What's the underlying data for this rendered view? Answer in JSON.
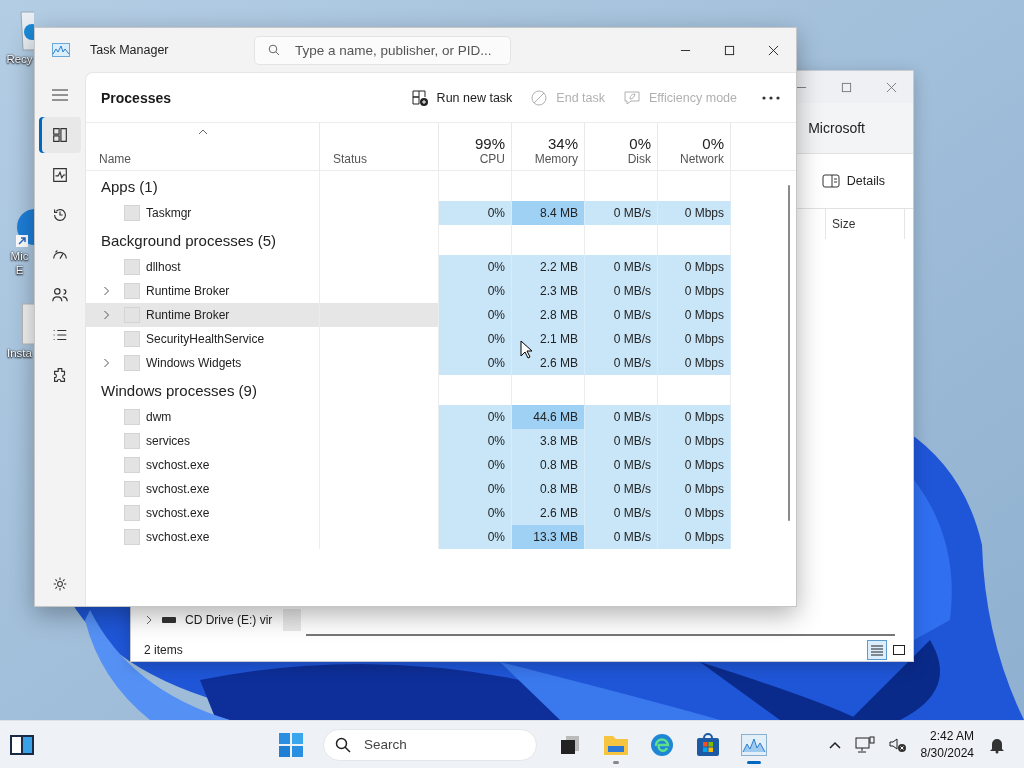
{
  "desktop": {
    "icons": [
      {
        "kind": "recycle",
        "lines": [
          "Recy"
        ]
      },
      {
        "kind": "edge",
        "lines": [
          "Mic",
          "E"
        ]
      },
      {
        "kind": "installer",
        "lines": [
          "Insta"
        ]
      }
    ]
  },
  "explorer": {
    "address": "Microsoft",
    "toolbar_button": "Details",
    "columns": [
      "Size"
    ],
    "nav_row": {
      "label": "CD Drive (E:) vir",
      "expandable": true
    },
    "status": "2 items",
    "views": [
      {
        "kind": "details",
        "selected": true
      },
      {
        "kind": "tiles",
        "selected": false
      }
    ]
  },
  "task_manager": {
    "title": "Task Manager",
    "search": {
      "placeholder": "Type a name, publisher, or PID..."
    },
    "nav": [
      {
        "kind": "processes",
        "selected": true
      },
      {
        "kind": "performance",
        "selected": false
      },
      {
        "kind": "history",
        "selected": false
      },
      {
        "kind": "startup",
        "selected": false
      },
      {
        "kind": "users",
        "selected": false
      },
      {
        "kind": "details",
        "selected": false
      },
      {
        "kind": "services",
        "selected": false
      }
    ],
    "page_title": "Processes",
    "toolbar": [
      {
        "kind": "run",
        "label": "Run new task",
        "disabled": false
      },
      {
        "kind": "end",
        "label": "End task",
        "disabled": true
      },
      {
        "kind": "efficiency",
        "label": "Efficiency mode",
        "disabled": true
      }
    ],
    "columns": [
      {
        "label": "Name",
        "sorted": true
      },
      {
        "label": "Status",
        "sorted": false
      },
      {
        "label": "CPU",
        "percent": "99%",
        "sorted": false
      },
      {
        "label": "Memory",
        "percent": "34%",
        "sorted": false
      },
      {
        "label": "Disk",
        "percent": "0%",
        "sorted": false
      },
      {
        "label": "Network",
        "percent": "0%",
        "sorted": false
      }
    ],
    "groups": [
      {
        "title": "Apps (1)",
        "rows": [
          {
            "name": "Taskmgr",
            "expandable": false,
            "hovered": false,
            "cpu": "0%",
            "memory": "8.4 MB",
            "memory_high": true,
            "disk": "0 MB/s",
            "network": "0 Mbps"
          }
        ]
      },
      {
        "title": "Background processes (5)",
        "rows": [
          {
            "name": "dllhost",
            "expandable": false,
            "hovered": false,
            "cpu": "0%",
            "memory": "2.2 MB",
            "memory_high": false,
            "disk": "0 MB/s",
            "network": "0 Mbps"
          },
          {
            "name": "Runtime Broker",
            "expandable": true,
            "hovered": false,
            "cpu": "0%",
            "memory": "2.3 MB",
            "memory_high": false,
            "disk": "0 MB/s",
            "network": "0 Mbps"
          },
          {
            "name": "Runtime Broker",
            "expandable": true,
            "hovered": true,
            "cpu": "0%",
            "memory": "2.8 MB",
            "memory_high": false,
            "disk": "0 MB/s",
            "network": "0 Mbps"
          },
          {
            "name": "SecurityHealthService",
            "expandable": false,
            "hovered": false,
            "cpu": "0%",
            "memory": "2.1 MB",
            "memory_high": false,
            "disk": "0 MB/s",
            "network": "0 Mbps"
          },
          {
            "name": "Windows Widgets",
            "expandable": true,
            "hovered": false,
            "cpu": "0%",
            "memory": "2.6 MB",
            "memory_high": false,
            "disk": "0 MB/s",
            "network": "0 Mbps"
          }
        ]
      },
      {
        "title": "Windows processes (9)",
        "rows": [
          {
            "name": "dwm",
            "expandable": false,
            "hovered": false,
            "cpu": "0%",
            "memory": "44.6 MB",
            "memory_high": true,
            "disk": "0 MB/s",
            "network": "0 Mbps"
          },
          {
            "name": "services",
            "expandable": false,
            "hovered": false,
            "cpu": "0%",
            "memory": "3.8 MB",
            "memory_high": false,
            "disk": "0 MB/s",
            "network": "0 Mbps"
          },
          {
            "name": "svchost.exe",
            "expandable": false,
            "hovered": false,
            "cpu": "0%",
            "memory": "0.8 MB",
            "memory_high": false,
            "disk": "0 MB/s",
            "network": "0 Mbps"
          },
          {
            "name": "svchost.exe",
            "expandable": false,
            "hovered": false,
            "cpu": "0%",
            "memory": "0.8 MB",
            "memory_high": false,
            "disk": "0 MB/s",
            "network": "0 Mbps"
          },
          {
            "name": "svchost.exe",
            "expandable": false,
            "hovered": false,
            "cpu": "0%",
            "memory": "2.6 MB",
            "memory_high": false,
            "disk": "0 MB/s",
            "network": "0 Mbps"
          },
          {
            "name": "svchost.exe",
            "expandable": false,
            "hovered": false,
            "cpu": "0%",
            "memory": "13.3 MB",
            "memory_high": true,
            "disk": "0 MB/s",
            "network": "0 Mbps"
          }
        ]
      }
    ]
  },
  "taskbar": {
    "search": {
      "placeholder": "Search"
    },
    "apps": [
      {
        "kind": "taskview",
        "running": false,
        "active": false
      },
      {
        "kind": "explorer",
        "running": true,
        "active": false
      },
      {
        "kind": "edge",
        "running": false,
        "active": false
      },
      {
        "kind": "store",
        "running": false,
        "active": false
      },
      {
        "kind": "taskmanager",
        "running": true,
        "active": true
      }
    ],
    "time": "2:42 AM",
    "date": "8/30/2024"
  }
}
